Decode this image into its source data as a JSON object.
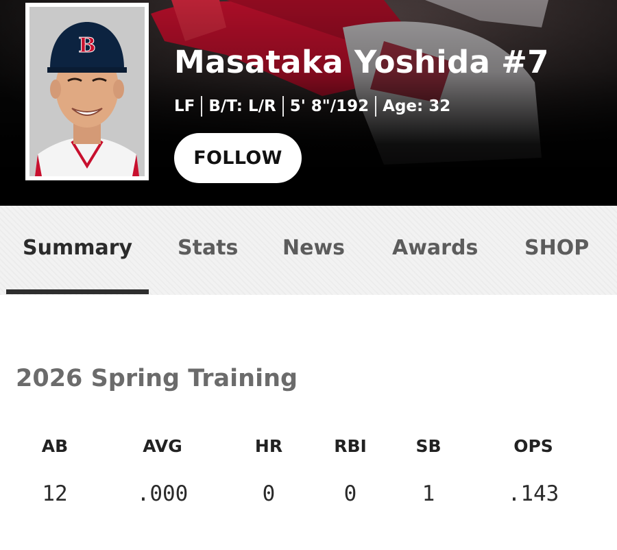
{
  "player": {
    "name": "Masataka Yoshida #7",
    "position": "LF",
    "bats_throws": "B/T: L/R",
    "height_weight": "5' 8\"/192",
    "age": "Age: 32",
    "cap_logo_letter": "B",
    "follow_label": "FOLLOW"
  },
  "tabs": [
    {
      "label": "Summary",
      "active": true
    },
    {
      "label": "Stats",
      "active": false
    },
    {
      "label": "News",
      "active": false
    },
    {
      "label": "Awards",
      "active": false
    },
    {
      "label": "SHOP",
      "active": false
    }
  ],
  "stats_section": {
    "title": "2026 Spring Training",
    "headers": [
      "AB",
      "AVG",
      "HR",
      "RBI",
      "SB",
      "OPS"
    ],
    "values": [
      "12",
      ".000",
      "0",
      "0",
      "1",
      ".143"
    ]
  },
  "colors": {
    "hero_background": "#000000",
    "jersey_red": "#c8102e",
    "cap_navy": "#0c2340",
    "tab_underline": "#2e2e2e",
    "tab_background": "#f2f2f2"
  },
  "icons": {
    "headshot": "player-headshot-image",
    "hero_background": "action-photo-background"
  }
}
